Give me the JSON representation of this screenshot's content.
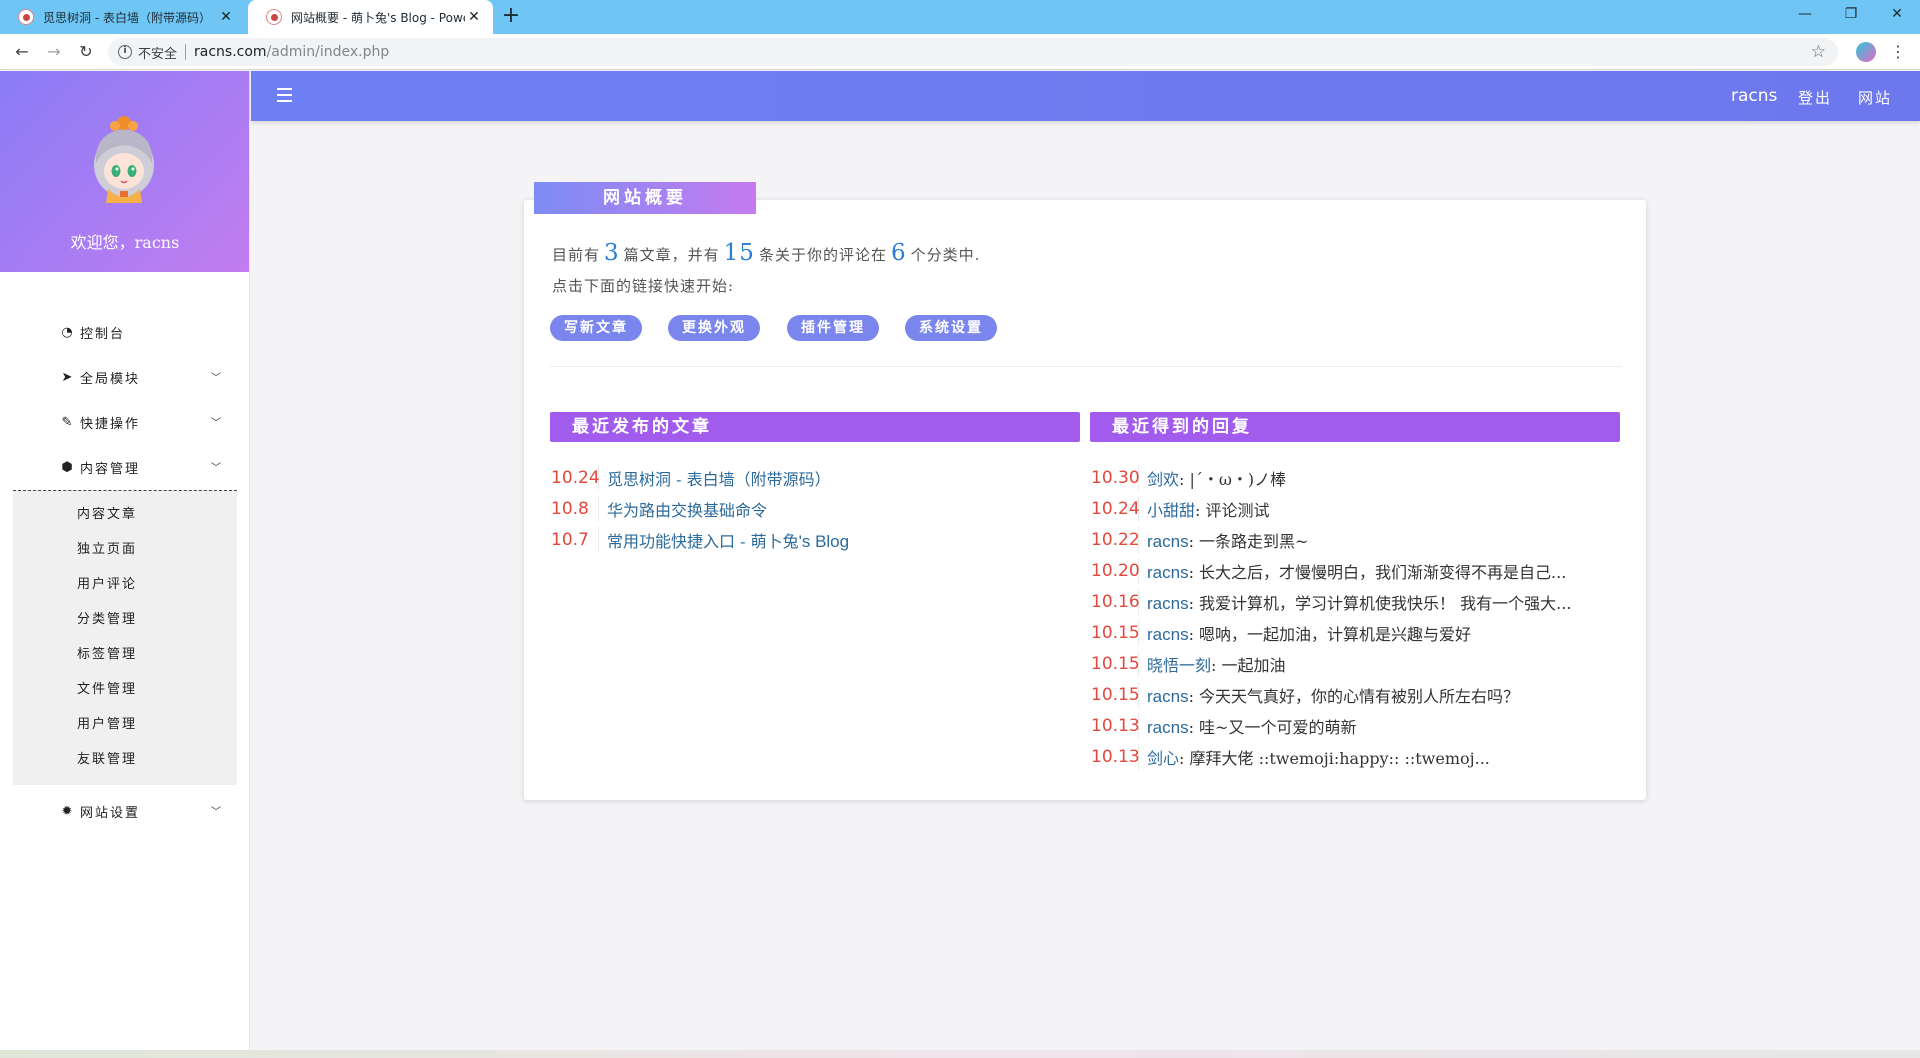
{
  "browser": {
    "tabs": [
      {
        "title": "觅思树洞 - 表白墙（附带源码）",
        "active": false
      },
      {
        "title": "网站概要 - 萌卜兔's Blog - Powered by Typecho",
        "active": true
      }
    ],
    "security_label": "不安全",
    "url_host": "racns.com",
    "url_path": "/admin/index.php"
  },
  "sidebar": {
    "welcome": "欢迎您，racns",
    "menu": [
      {
        "label": "控制台",
        "icon": "dashboard-icon",
        "glyph": "◔",
        "has_children": false
      },
      {
        "label": "全局模块",
        "icon": "paper-plane-icon",
        "glyph": "➤",
        "has_children": true
      },
      {
        "label": "快捷操作",
        "icon": "pencil-icon",
        "glyph": "✎",
        "has_children": true
      },
      {
        "label": "内容管理",
        "icon": "cube-icon",
        "glyph": "⬢",
        "has_children": true
      }
    ],
    "content_submenu": [
      "内容文章",
      "独立页面",
      "用户评论",
      "分类管理",
      "标签管理",
      "文件管理",
      "用户管理",
      "友联管理"
    ],
    "settings": {
      "label": "网站设置",
      "icon": "gear-icon",
      "glyph": "✹"
    }
  },
  "topbar": {
    "user": "racns",
    "logout": "登出",
    "site": "网站"
  },
  "overview": {
    "title": "网站概要",
    "text_before_posts": "目前有",
    "posts_count": "3",
    "text_after_posts": "篇文章，并有",
    "comments_count": "15",
    "text_after_comments": "条关于你的评论在",
    "categories_count": "6",
    "text_after_categories": "个分类中.",
    "hint": "点击下面的链接快速开始:",
    "quick_links": [
      "写新文章",
      "更换外观",
      "插件管理",
      "系统设置"
    ]
  },
  "recent_posts": {
    "heading": "最近发布的文章",
    "items": [
      {
        "date": "10.24",
        "title_zh": "觅思树洞 - 表白墙（附带源码）",
        "title_en": ""
      },
      {
        "date": "10.8",
        "title_zh": "华为路由交换基础命令",
        "title_en": ""
      },
      {
        "date": "10.7",
        "title_zh": "常用功能快捷入口 - 萌卜兔",
        "title_en": "'s Blog"
      }
    ]
  },
  "recent_replies": {
    "heading": "最近得到的回复",
    "items": [
      {
        "date": "10.30",
        "author": "剑欢",
        "author_latin": false,
        "text": ": |´・ω・)ノ棒"
      },
      {
        "date": "10.24",
        "author": "小甜甜",
        "author_latin": false,
        "text": ": 评论测试"
      },
      {
        "date": "10.22",
        "author": "racns",
        "author_latin": true,
        "text": ": 一条路走到黑~"
      },
      {
        "date": "10.20",
        "author": "racns",
        "author_latin": true,
        "text": ": 长大之后，才慢慢明白，我们渐渐变得不再是自己..."
      },
      {
        "date": "10.16",
        "author": "racns",
        "author_latin": true,
        "text": ": 我爱计算机，学习计算机使我快乐！ 我有一个强大..."
      },
      {
        "date": "10.15",
        "author": "racns",
        "author_latin": true,
        "text": ": 嗯呐，一起加油，计算机是兴趣与爱好"
      },
      {
        "date": "10.15",
        "author": "晓悟一刻",
        "author_latin": false,
        "text": ": 一起加油"
      },
      {
        "date": "10.15",
        "author": "racns",
        "author_latin": true,
        "text": ": 今天天气真好，你的心情有被别人所左右吗？"
      },
      {
        "date": "10.13",
        "author": "racns",
        "author_latin": true,
        "text": ": 哇~又一个可爱的萌新"
      },
      {
        "date": "10.13",
        "author": "剑心",
        "author_latin": false,
        "text": ": 摩拜大佬 ::twemoji:happy:: ::twemoj..."
      }
    ]
  },
  "colors": {
    "accent": "#7a86ee",
    "section_bar": "#a25ced",
    "date": "#e2483b",
    "link": "#2d6a9c",
    "count": "#2a7dd6"
  }
}
